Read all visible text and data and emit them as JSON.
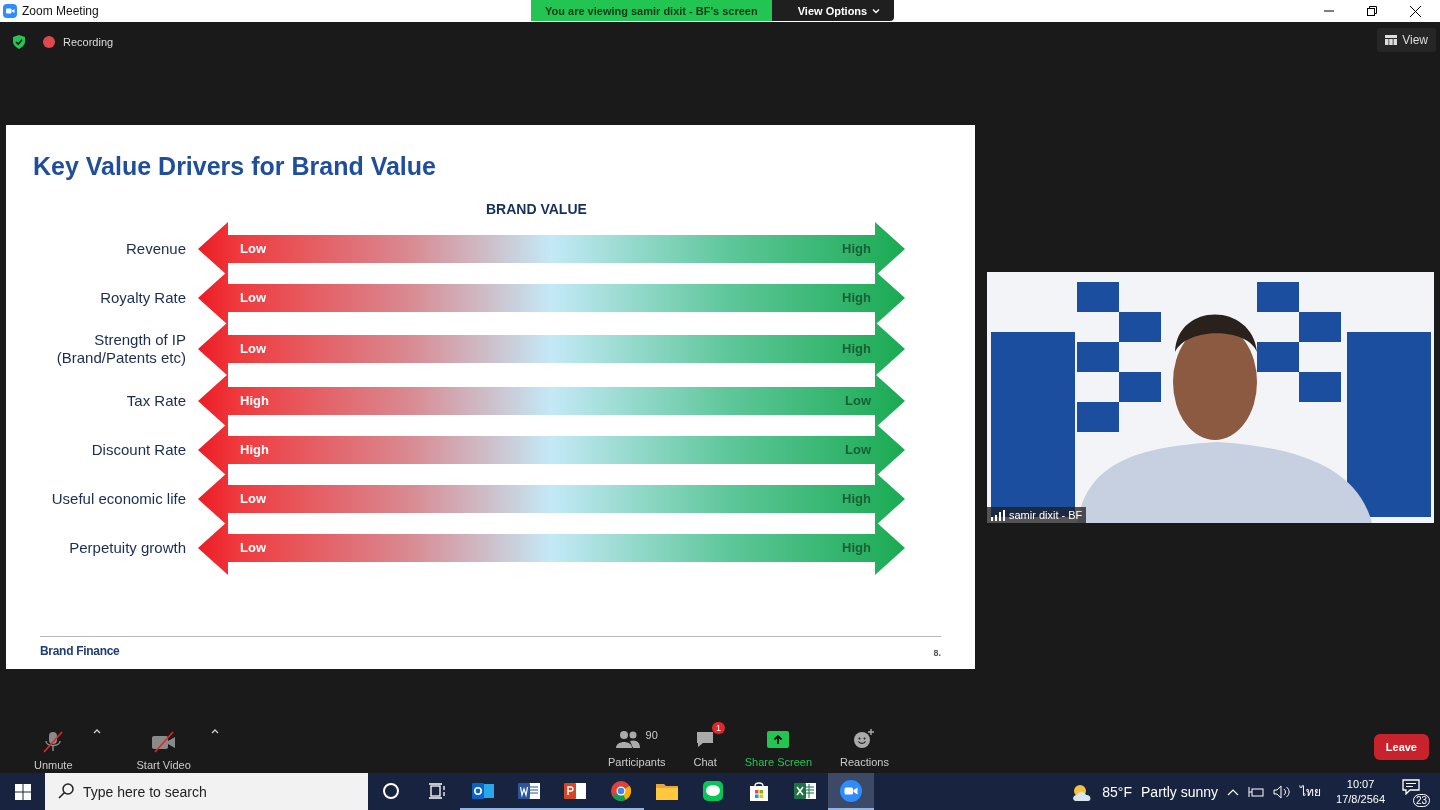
{
  "window": {
    "title": "Zoom Meeting"
  },
  "banner": {
    "text": "You are viewing samir dixit - BF's screen",
    "view_options": "View Options"
  },
  "infobar": {
    "recording": "Recording",
    "view": "View"
  },
  "slide": {
    "title": "Key Value Drivers for Brand Value",
    "header": "BRAND VALUE",
    "rows": [
      {
        "label": "Revenue",
        "left": "Low",
        "right": "High"
      },
      {
        "label": "Royalty Rate",
        "left": "Low",
        "right": "High"
      },
      {
        "label": "Strength of IP\n(Brand/Patents etc)",
        "left": "Low",
        "right": "High"
      },
      {
        "label": "Tax Rate",
        "left": "High",
        "right": "Low"
      },
      {
        "label": "Discount Rate",
        "left": "High",
        "right": "Low"
      },
      {
        "label": "Useful economic life",
        "left": "Low",
        "right": "High"
      },
      {
        "label": "Perpetuity growth",
        "left": "Low",
        "right": "High"
      }
    ],
    "footer_logo": "Brand Finance",
    "page": "8."
  },
  "video": {
    "kind": "picture",
    "name": "samir dixit - BF"
  },
  "toolbar": {
    "left": [
      {
        "kind": "mic",
        "label": "Unmute",
        "off": true
      },
      {
        "kind": "camera",
        "label": "Start Video",
        "off": true
      }
    ],
    "center": [
      {
        "kind": "participants",
        "label": "Participants",
        "count": "90"
      },
      {
        "kind": "chat",
        "label": "Chat",
        "badge": "1"
      },
      {
        "kind": "share",
        "label": "Share Screen"
      },
      {
        "kind": "reactions",
        "label": "Reactions"
      }
    ],
    "leave": "Leave"
  },
  "taskbar": {
    "search": {
      "placeholder": "Type here to search"
    },
    "apps": [
      {
        "kind": "cortana",
        "running": false,
        "selected": false
      },
      {
        "kind": "taskview",
        "running": false,
        "selected": false
      },
      {
        "kind": "outlook",
        "running": true,
        "selected": false
      },
      {
        "kind": "word",
        "running": true,
        "selected": false
      },
      {
        "kind": "powerpoint",
        "running": true,
        "selected": false
      },
      {
        "kind": "chrome",
        "running": true,
        "selected": false
      },
      {
        "kind": "explorer",
        "running": false,
        "selected": false
      },
      {
        "kind": "line",
        "running": false,
        "selected": false
      },
      {
        "kind": "store",
        "running": false,
        "selected": false
      },
      {
        "kind": "excel",
        "running": false,
        "selected": false
      },
      {
        "kind": "zoom",
        "running": true,
        "selected": true
      }
    ],
    "weather": {
      "temp": "85°F",
      "condition": "Partly sunny"
    },
    "language": "ไทย",
    "time": "10:07",
    "date": "17/8/2564",
    "notifications": "23"
  }
}
